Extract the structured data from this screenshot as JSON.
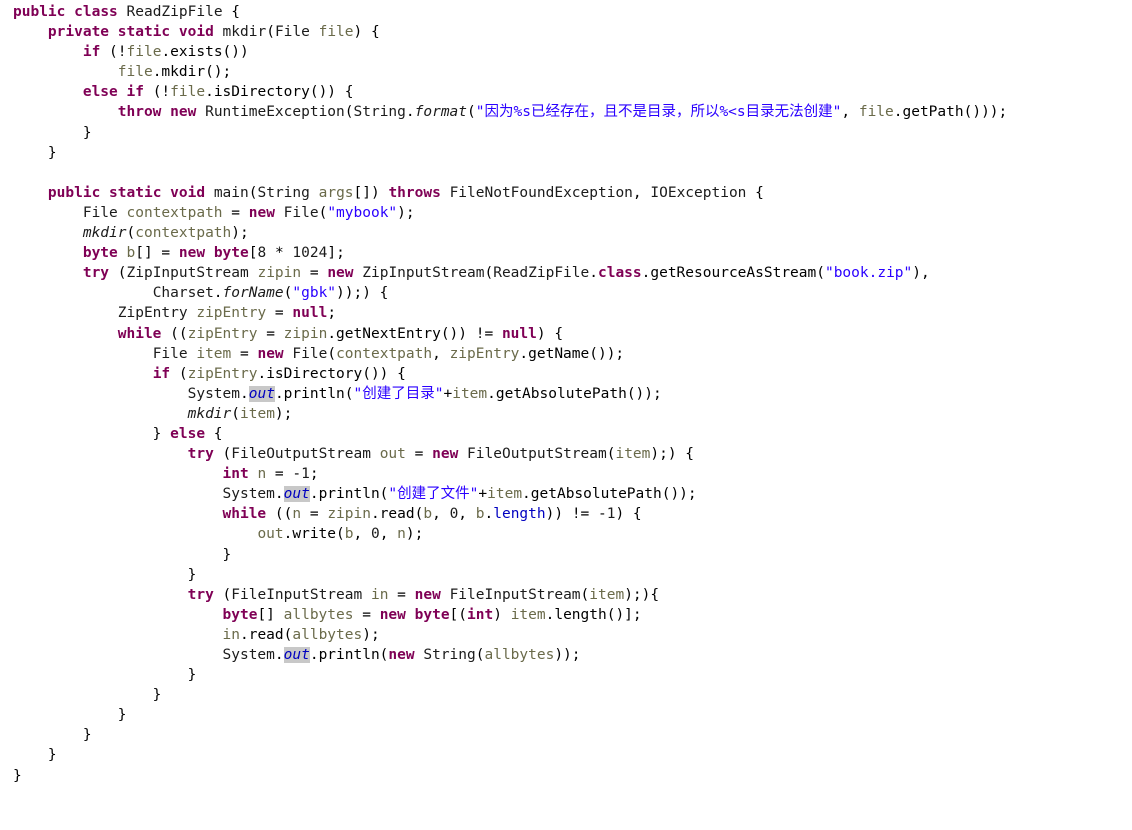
{
  "editor": {
    "language": "Java",
    "font_size_px": 14.5,
    "line_height_px": 20.1,
    "background": "#ffffff",
    "colors": {
      "keyword": "#7f0055",
      "string": "#2a00ff",
      "field": "#0000c0",
      "local_variable": "#6a6a4a",
      "type": "#1b1b1b",
      "occurrence_highlight": "#c8c8c8"
    }
  },
  "code": {
    "lines": [
      "public class ReadZipFile {",
      "    private static void mkdir(File file) {",
      "        if (!file.exists())",
      "            file.mkdir();",
      "        else if (!file.isDirectory()) {",
      "            throw new RuntimeException(String.format(\"因为%s已经存在，且不是目录，所以%<s目录无法创建\", file.getPath()));",
      "        }",
      "    }",
      "",
      "    public static void main(String args[]) throws FileNotFoundException, IOException {",
      "        File contextpath = new File(\"mybook\");",
      "        mkdir(contextpath);",
      "        byte b[] = new byte[8 * 1024];",
      "        try (ZipInputStream zipin = new ZipInputStream(ReadZipFile.class.getResourceAsStream(\"book.zip\"),",
      "                Charset.forName(\"gbk\"));) {",
      "            ZipEntry zipEntry = null;",
      "            while ((zipEntry = zipin.getNextEntry()) != null) {",
      "                File item = new File(contextpath, zipEntry.getName());",
      "                if (zipEntry.isDirectory()) {",
      "                    System.out.println(\"创建了目录\"+item.getAbsolutePath());",
      "                    mkdir(item);",
      "                } else {",
      "                    try (FileOutputStream out = new FileOutputStream(item);) {",
      "                        int n = -1;",
      "                        System.out.println(\"创建了文件\"+item.getAbsolutePath());",
      "                        while ((n = zipin.read(b, 0, b.length)) != -1) {",
      "                            out.write(b, 0, n);",
      "                        }",
      "                    }",
      "                    try (FileInputStream in = new FileInputStream(item);){",
      "                        byte[] allbytes = new byte[(int) item.length()];",
      "                        in.read(allbytes);",
      "                        System.out.println(new String(allbytes));",
      "                    }",
      "                }",
      "            }",
      "        }",
      "    }",
      "}"
    ],
    "tokens": [
      [
        [
          "kw",
          "public"
        ],
        [
          "pun",
          " "
        ],
        [
          "kw",
          "class"
        ],
        [
          "pun",
          " "
        ],
        [
          "typ",
          "ReadZipFile"
        ],
        [
          "pun",
          " {"
        ]
      ],
      [
        [
          "pun",
          "    "
        ],
        [
          "kw",
          "private"
        ],
        [
          "pun",
          " "
        ],
        [
          "kw",
          "static"
        ],
        [
          "pun",
          " "
        ],
        [
          "kw",
          "void"
        ],
        [
          "pun",
          " "
        ],
        [
          "typ",
          "mkdir"
        ],
        [
          "pun",
          "("
        ],
        [
          "typ",
          "File"
        ],
        [
          "pun",
          " "
        ],
        [
          "var",
          "file"
        ],
        [
          "pun",
          ") {"
        ]
      ],
      [
        [
          "pun",
          "        "
        ],
        [
          "kw",
          "if"
        ],
        [
          "pun",
          " (!"
        ],
        [
          "var",
          "file"
        ],
        [
          "pun",
          ".exists())"
        ]
      ],
      [
        [
          "pun",
          "            "
        ],
        [
          "var",
          "file"
        ],
        [
          "pun",
          ".mkdir();"
        ]
      ],
      [
        [
          "pun",
          "        "
        ],
        [
          "kw",
          "else"
        ],
        [
          "pun",
          " "
        ],
        [
          "kw",
          "if"
        ],
        [
          "pun",
          " (!"
        ],
        [
          "var",
          "file"
        ],
        [
          "pun",
          ".isDirectory()) {"
        ]
      ],
      [
        [
          "pun",
          "            "
        ],
        [
          "kw",
          "throw"
        ],
        [
          "pun",
          " "
        ],
        [
          "kw",
          "new"
        ],
        [
          "pun",
          " "
        ],
        [
          "typ",
          "RuntimeException"
        ],
        [
          "pun",
          "("
        ],
        [
          "typ",
          "String"
        ],
        [
          "pun",
          "."
        ],
        [
          "mtd",
          "format"
        ],
        [
          "pun",
          "("
        ],
        [
          "str",
          "\"因为%s已经存在，且不是目录，所以%<s目录无法创建\""
        ],
        [
          "pun",
          ", "
        ],
        [
          "var",
          "file"
        ],
        [
          "pun",
          ".getPath()));"
        ]
      ],
      [
        [
          "pun",
          "        }"
        ]
      ],
      [
        [
          "pun",
          "    }"
        ]
      ],
      [
        [
          "pun",
          ""
        ]
      ],
      [
        [
          "pun",
          "    "
        ],
        [
          "kw",
          "public"
        ],
        [
          "pun",
          " "
        ],
        [
          "kw",
          "static"
        ],
        [
          "pun",
          " "
        ],
        [
          "kw",
          "void"
        ],
        [
          "pun",
          " "
        ],
        [
          "typ",
          "main"
        ],
        [
          "pun",
          "("
        ],
        [
          "typ",
          "String"
        ],
        [
          "pun",
          " "
        ],
        [
          "var",
          "args"
        ],
        [
          "pun",
          "[]) "
        ],
        [
          "kw",
          "throws"
        ],
        [
          "pun",
          " "
        ],
        [
          "typ",
          "FileNotFoundException"
        ],
        [
          "pun",
          ", "
        ],
        [
          "typ",
          "IOException"
        ],
        [
          "pun",
          " {"
        ]
      ],
      [
        [
          "pun",
          "        "
        ],
        [
          "typ",
          "File"
        ],
        [
          "pun",
          " "
        ],
        [
          "var",
          "contextpath"
        ],
        [
          "pun",
          " = "
        ],
        [
          "kw",
          "new"
        ],
        [
          "pun",
          " "
        ],
        [
          "typ",
          "File"
        ],
        [
          "pun",
          "("
        ],
        [
          "str",
          "\"mybook\""
        ],
        [
          "pun",
          ");"
        ]
      ],
      [
        [
          "pun",
          "        "
        ],
        [
          "mtd",
          "mkdir"
        ],
        [
          "pun",
          "("
        ],
        [
          "var",
          "contextpath"
        ],
        [
          "pun",
          ");"
        ]
      ],
      [
        [
          "pun",
          "        "
        ],
        [
          "kw",
          "byte"
        ],
        [
          "pun",
          " "
        ],
        [
          "var",
          "b"
        ],
        [
          "pun",
          "[] = "
        ],
        [
          "kw",
          "new"
        ],
        [
          "pun",
          " "
        ],
        [
          "kw",
          "byte"
        ],
        [
          "pun",
          "["
        ],
        [
          "num",
          "8"
        ],
        [
          "pun",
          " * "
        ],
        [
          "num",
          "1024"
        ],
        [
          "pun",
          "];"
        ]
      ],
      [
        [
          "pun",
          "        "
        ],
        [
          "kw",
          "try"
        ],
        [
          "pun",
          " ("
        ],
        [
          "typ",
          "ZipInputStream"
        ],
        [
          "pun",
          " "
        ],
        [
          "var",
          "zipin"
        ],
        [
          "pun",
          " = "
        ],
        [
          "kw",
          "new"
        ],
        [
          "pun",
          " "
        ],
        [
          "typ",
          "ZipInputStream"
        ],
        [
          "pun",
          "("
        ],
        [
          "typ",
          "ReadZipFile"
        ],
        [
          "pun",
          "."
        ],
        [
          "kw",
          "class"
        ],
        [
          "pun",
          ".getResourceAsStream("
        ],
        [
          "str",
          "\"book.zip\""
        ],
        [
          "pun",
          "),"
        ]
      ],
      [
        [
          "pun",
          "                "
        ],
        [
          "typ",
          "Charset"
        ],
        [
          "pun",
          "."
        ],
        [
          "mtd",
          "forName"
        ],
        [
          "pun",
          "("
        ],
        [
          "str",
          "\"gbk\""
        ],
        [
          "pun",
          "));) {"
        ]
      ],
      [
        [
          "pun",
          "            "
        ],
        [
          "typ",
          "ZipEntry"
        ],
        [
          "pun",
          " "
        ],
        [
          "var",
          "zipEntry"
        ],
        [
          "pun",
          " = "
        ],
        [
          "kw",
          "null"
        ],
        [
          "pun",
          ";"
        ]
      ],
      [
        [
          "pun",
          "            "
        ],
        [
          "kw",
          "while"
        ],
        [
          "pun",
          " (("
        ],
        [
          "var",
          "zipEntry"
        ],
        [
          "pun",
          " = "
        ],
        [
          "var",
          "zipin"
        ],
        [
          "pun",
          ".getNextEntry()) != "
        ],
        [
          "kw",
          "null"
        ],
        [
          "pun",
          ") {"
        ]
      ],
      [
        [
          "pun",
          "                "
        ],
        [
          "typ",
          "File"
        ],
        [
          "pun",
          " "
        ],
        [
          "var",
          "item"
        ],
        [
          "pun",
          " = "
        ],
        [
          "kw",
          "new"
        ],
        [
          "pun",
          " "
        ],
        [
          "typ",
          "File"
        ],
        [
          "pun",
          "("
        ],
        [
          "var",
          "contextpath"
        ],
        [
          "pun",
          ", "
        ],
        [
          "var",
          "zipEntry"
        ],
        [
          "pun",
          ".getName());"
        ]
      ],
      [
        [
          "pun",
          "                "
        ],
        [
          "kw",
          "if"
        ],
        [
          "pun",
          " ("
        ],
        [
          "var",
          "zipEntry"
        ],
        [
          "pun",
          ".isDirectory()) {"
        ]
      ],
      [
        [
          "pun",
          "                    "
        ],
        [
          "typ",
          "System"
        ],
        [
          "pun",
          "."
        ],
        [
          "out",
          "out"
        ],
        [
          "pun",
          ".println("
        ],
        [
          "str",
          "\"创建了目录\""
        ],
        [
          "pun",
          "+"
        ],
        [
          "var",
          "item"
        ],
        [
          "pun",
          ".getAbsolutePath());"
        ]
      ],
      [
        [
          "pun",
          "                    "
        ],
        [
          "mtd",
          "mkdir"
        ],
        [
          "pun",
          "("
        ],
        [
          "var",
          "item"
        ],
        [
          "pun",
          ");"
        ]
      ],
      [
        [
          "pun",
          "                } "
        ],
        [
          "kw",
          "else"
        ],
        [
          "pun",
          " {"
        ]
      ],
      [
        [
          "pun",
          "                    "
        ],
        [
          "kw",
          "try"
        ],
        [
          "pun",
          " ("
        ],
        [
          "typ",
          "FileOutputStream"
        ],
        [
          "pun",
          " "
        ],
        [
          "var",
          "out"
        ],
        [
          "pun",
          " = "
        ],
        [
          "kw",
          "new"
        ],
        [
          "pun",
          " "
        ],
        [
          "typ",
          "FileOutputStream"
        ],
        [
          "pun",
          "("
        ],
        [
          "var",
          "item"
        ],
        [
          "pun",
          ");) {"
        ]
      ],
      [
        [
          "pun",
          "                        "
        ],
        [
          "kw",
          "int"
        ],
        [
          "pun",
          " "
        ],
        [
          "var",
          "n"
        ],
        [
          "pun",
          " = -"
        ],
        [
          "num",
          "1"
        ],
        [
          "pun",
          ";"
        ]
      ],
      [
        [
          "pun",
          "                        "
        ],
        [
          "typ",
          "System"
        ],
        [
          "pun",
          "."
        ],
        [
          "out",
          "out"
        ],
        [
          "pun",
          ".println("
        ],
        [
          "str",
          "\"创建了文件\""
        ],
        [
          "pun",
          "+"
        ],
        [
          "var",
          "item"
        ],
        [
          "pun",
          ".getAbsolutePath());"
        ]
      ],
      [
        [
          "pun",
          "                        "
        ],
        [
          "kw",
          "while"
        ],
        [
          "pun",
          " (("
        ],
        [
          "var",
          "n"
        ],
        [
          "pun",
          " = "
        ],
        [
          "var",
          "zipin"
        ],
        [
          "pun",
          ".read("
        ],
        [
          "var",
          "b"
        ],
        [
          "pun",
          ", "
        ],
        [
          "num",
          "0"
        ],
        [
          "pun",
          ", "
        ],
        [
          "var",
          "b"
        ],
        [
          "pun",
          "."
        ],
        [
          "fld",
          "length"
        ],
        [
          "pun",
          ")) != -"
        ],
        [
          "num",
          "1"
        ],
        [
          "pun",
          ") {"
        ]
      ],
      [
        [
          "pun",
          "                            "
        ],
        [
          "var",
          "out"
        ],
        [
          "pun",
          ".write("
        ],
        [
          "var",
          "b"
        ],
        [
          "pun",
          ", "
        ],
        [
          "num",
          "0"
        ],
        [
          "pun",
          ", "
        ],
        [
          "var",
          "n"
        ],
        [
          "pun",
          ");"
        ]
      ],
      [
        [
          "pun",
          "                        }"
        ]
      ],
      [
        [
          "pun",
          "                    }"
        ]
      ],
      [
        [
          "pun",
          "                    "
        ],
        [
          "kw",
          "try"
        ],
        [
          "pun",
          " ("
        ],
        [
          "typ",
          "FileInputStream"
        ],
        [
          "pun",
          " "
        ],
        [
          "var",
          "in"
        ],
        [
          "pun",
          " = "
        ],
        [
          "kw",
          "new"
        ],
        [
          "pun",
          " "
        ],
        [
          "typ",
          "FileInputStream"
        ],
        [
          "pun",
          "("
        ],
        [
          "var",
          "item"
        ],
        [
          "pun",
          ");){"
        ]
      ],
      [
        [
          "pun",
          "                        "
        ],
        [
          "kw",
          "byte"
        ],
        [
          "pun",
          "[] "
        ],
        [
          "var",
          "allbytes"
        ],
        [
          "pun",
          " = "
        ],
        [
          "kw",
          "new"
        ],
        [
          "pun",
          " "
        ],
        [
          "kw",
          "byte"
        ],
        [
          "pun",
          "[("
        ],
        [
          "kw",
          "int"
        ],
        [
          "pun",
          ") "
        ],
        [
          "var",
          "item"
        ],
        [
          "pun",
          ".length()];"
        ]
      ],
      [
        [
          "pun",
          "                        "
        ],
        [
          "var",
          "in"
        ],
        [
          "pun",
          ".read("
        ],
        [
          "var",
          "allbytes"
        ],
        [
          "pun",
          ");"
        ]
      ],
      [
        [
          "pun",
          "                        "
        ],
        [
          "typ",
          "System"
        ],
        [
          "pun",
          "."
        ],
        [
          "out",
          "out"
        ],
        [
          "pun",
          ".println("
        ],
        [
          "kw",
          "new"
        ],
        [
          "pun",
          " "
        ],
        [
          "typ",
          "String"
        ],
        [
          "pun",
          "("
        ],
        [
          "var",
          "allbytes"
        ],
        [
          "pun",
          "));"
        ]
      ],
      [
        [
          "pun",
          "                    }"
        ]
      ],
      [
        [
          "pun",
          "                }"
        ]
      ],
      [
        [
          "pun",
          "            }"
        ]
      ],
      [
        [
          "pun",
          "        }"
        ]
      ],
      [
        [
          "pun",
          "    }"
        ]
      ],
      [
        [
          "pun",
          "}"
        ]
      ]
    ]
  }
}
